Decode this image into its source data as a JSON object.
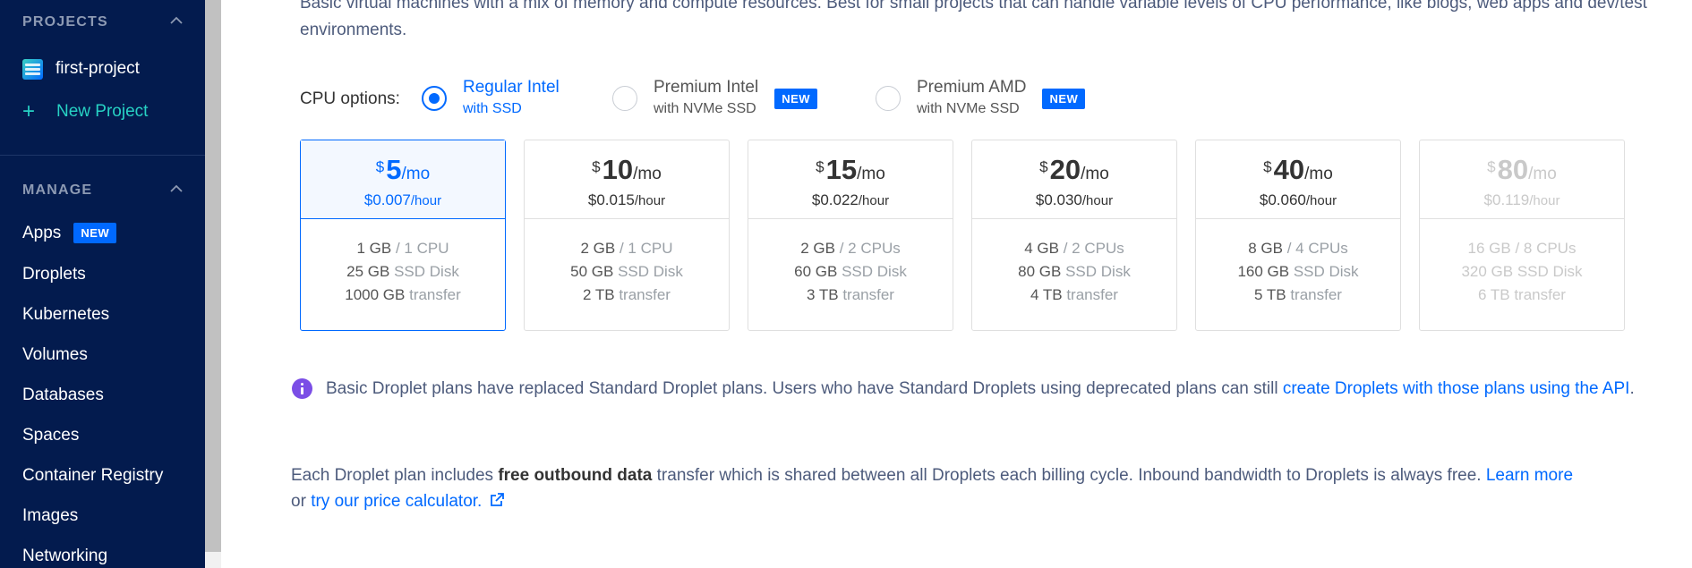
{
  "sidebar": {
    "projects_heading": "PROJECTS",
    "project_name": "first-project",
    "new_project_label": "New Project",
    "manage_heading": "MANAGE",
    "items": [
      {
        "label": "Apps",
        "badge": "NEW"
      },
      {
        "label": "Droplets"
      },
      {
        "label": "Kubernetes"
      },
      {
        "label": "Volumes"
      },
      {
        "label": "Databases"
      },
      {
        "label": "Spaces"
      },
      {
        "label": "Container Registry"
      },
      {
        "label": "Images"
      },
      {
        "label": "Networking"
      }
    ]
  },
  "main": {
    "intro": "Basic virtual machines with a mix of memory and compute resources. Best for small projects that can handle variable levels of CPU performance, like blogs, web apps and dev/test environments.",
    "cpu_label": "CPU options:",
    "cpu_options": [
      {
        "name": "Regular Intel",
        "sub": "with SSD",
        "selected": true
      },
      {
        "name": "Premium Intel",
        "sub": "with NVMe SSD",
        "badge": "NEW"
      },
      {
        "name": "Premium AMD",
        "sub": "with NVMe SSD",
        "badge": "NEW"
      }
    ],
    "plans": [
      {
        "currency": "$",
        "amount": "5",
        "per": "/mo",
        "hourly": "$0.007",
        "hourly_unit": "/hour",
        "mem": "1 GB",
        "cpu": " / 1 CPU",
        "disk": "25 GB",
        "disk_label": " SSD Disk",
        "transfer": "1000 GB",
        "transfer_label": " transfer"
      },
      {
        "currency": "$",
        "amount": "10",
        "per": "/mo",
        "hourly": "$0.015",
        "hourly_unit": "/hour",
        "mem": "2 GB",
        "cpu": " / 1 CPU",
        "disk": "50 GB",
        "disk_label": " SSD Disk",
        "transfer": "2 TB",
        "transfer_label": " transfer"
      },
      {
        "currency": "$",
        "amount": "15",
        "per": "/mo",
        "hourly": "$0.022",
        "hourly_unit": "/hour",
        "mem": "2 GB",
        "cpu": " / 2 CPUs",
        "disk": "60 GB",
        "disk_label": " SSD Disk",
        "transfer": "3 TB",
        "transfer_label": " transfer"
      },
      {
        "currency": "$",
        "amount": "20",
        "per": "/mo",
        "hourly": "$0.030",
        "hourly_unit": "/hour",
        "mem": "4 GB",
        "cpu": " / 2 CPUs",
        "disk": "80 GB",
        "disk_label": " SSD Disk",
        "transfer": "4 TB",
        "transfer_label": " transfer"
      },
      {
        "currency": "$",
        "amount": "40",
        "per": "/mo",
        "hourly": "$0.060",
        "hourly_unit": "/hour",
        "mem": "8 GB",
        "cpu": " / 4 CPUs",
        "disk": "160 GB",
        "disk_label": " SSD Disk",
        "transfer": "5 TB",
        "transfer_label": " transfer"
      },
      {
        "currency": "$",
        "amount": "80",
        "per": "/mo",
        "hourly": "$0.119",
        "hourly_unit": "/hour",
        "mem": "16 GB",
        "cpu": " / 8 CPUs",
        "disk": "320 GB",
        "disk_label": " SSD Disk",
        "transfer": "6 TB",
        "transfer_label": " transfer"
      }
    ],
    "info": {
      "text": "Basic Droplet plans have replaced Standard Droplet plans. Users who have Standard Droplets using deprecated plans can still ",
      "link": "create Droplets with those plans using the API",
      "end": "."
    },
    "footer": {
      "t1": "Each Droplet plan includes ",
      "bold": "free outbound data",
      "t2": " transfer which is shared between all Droplets each billing cycle. Inbound bandwidth to Droplets is always free. ",
      "learn_more": "Learn more",
      "or": " or ",
      "calc_link": "try our price calculator."
    }
  },
  "colors": {
    "sidebar_bg": "#031b4e",
    "accent": "#0069ff",
    "teal": "#27d2c4",
    "info_purple": "#7b4ee6"
  }
}
